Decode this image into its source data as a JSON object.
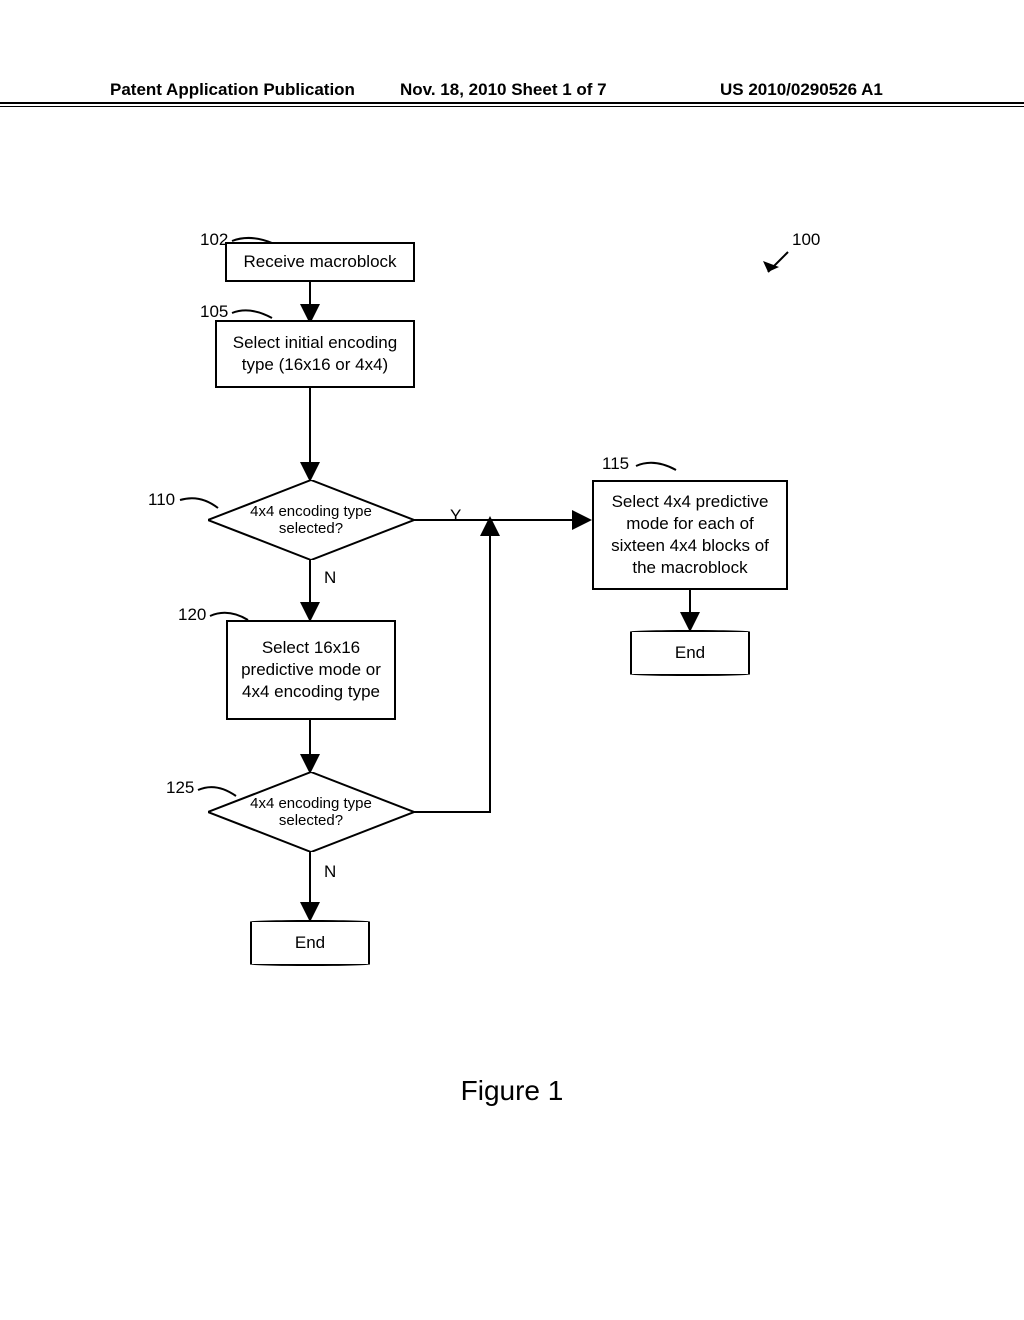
{
  "header": {
    "left": "Patent Application Publication",
    "center": "Nov. 18, 2010  Sheet 1 of 7",
    "right": "US 2010/0290526 A1"
  },
  "refs": {
    "r100": "100",
    "r102": "102",
    "r105": "105",
    "r110": "110",
    "r115": "115",
    "r120": "120",
    "r125": "125"
  },
  "blocks": {
    "b102": "Receive macroblock",
    "b105": "Select initial encoding\ntype (16x16 or 4x4)",
    "d110": "4x4 encoding type\nselected?",
    "b115": "Select 4x4 predictive\nmode for each of\nsixteen 4x4 blocks of\nthe macroblock",
    "b120": "Select 16x16\npredictive mode or\n4x4 encoding type",
    "d125": "4x4 encoding type\nselected?",
    "end": "End"
  },
  "branches": {
    "yes": "Y",
    "no": "N"
  },
  "caption": "Figure 1"
}
